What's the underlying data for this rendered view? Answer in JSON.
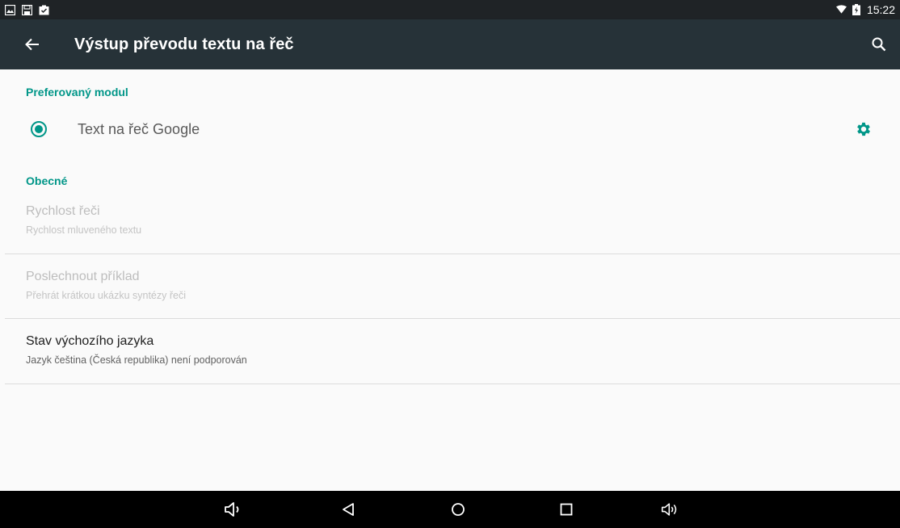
{
  "status_bar": {
    "time": "15:22",
    "left_icons": [
      "image-notification-icon",
      "save-notification-icon",
      "task-notification-icon"
    ],
    "right_icons": [
      "wifi-icon",
      "battery-charging-icon"
    ]
  },
  "app_bar": {
    "title": "Výstup převodu textu na řeč",
    "bg_color": "#263238"
  },
  "preferred_engine": {
    "section_title": "Preferovaný modul",
    "engine_label": "Text na řeč Google",
    "selected": true
  },
  "general": {
    "section_title": "Obecné",
    "items": [
      {
        "title": "Rychlost řeči",
        "summary": "Rychlost mluveného textu",
        "enabled": false
      },
      {
        "title": "Poslechnout příklad",
        "summary": "Přehrát krátkou ukázku syntézy řeči",
        "enabled": false
      },
      {
        "title": "Stav výchozího jazyka",
        "summary": "Jazyk čeština (Česká republika) není podporován",
        "enabled": true
      }
    ]
  },
  "nav_bar": {
    "buttons": [
      "volume-down-icon",
      "back-icon",
      "home-icon",
      "recents-icon",
      "volume-up-icon"
    ]
  },
  "colors": {
    "accent": "#009688"
  }
}
